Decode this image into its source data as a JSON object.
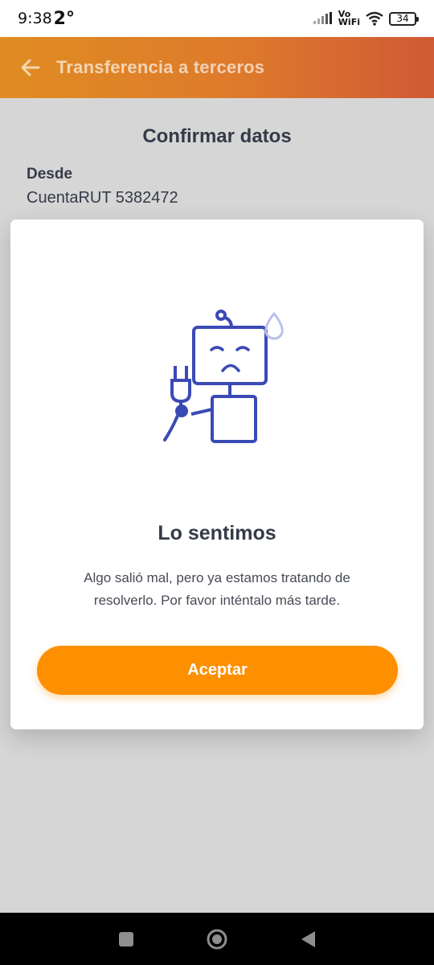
{
  "status_bar": {
    "time": "9:38",
    "temperature": "2°",
    "network_label": "Vo\nWiFi",
    "battery_level": "34"
  },
  "header": {
    "title": "Transferencia a terceros",
    "back_icon": "arrow-left-icon"
  },
  "background": {
    "section_title": "Confirmar datos",
    "from_label": "Desde",
    "from_value": "CuentaRUT 5382472"
  },
  "error_dialog": {
    "illustration": "robot-unplugged-icon",
    "title": "Lo sentimos",
    "message": "Algo salió mal, pero ya estamos tratando de resolverlo. Por favor inténtalo más tarde.",
    "accept_label": "Aceptar"
  },
  "navigation_bar": {
    "buttons": [
      "square-recents-icon",
      "circle-home-icon",
      "triangle-back-icon"
    ]
  },
  "colors": {
    "header_gradient_start": "#e08c22",
    "header_gradient_end": "#cf5a35",
    "accent_button": "#fd8f01",
    "illustration_blue": "#3a4ab5",
    "text_dark": "#353a47",
    "overlay_background": "#d6d6d6"
  }
}
